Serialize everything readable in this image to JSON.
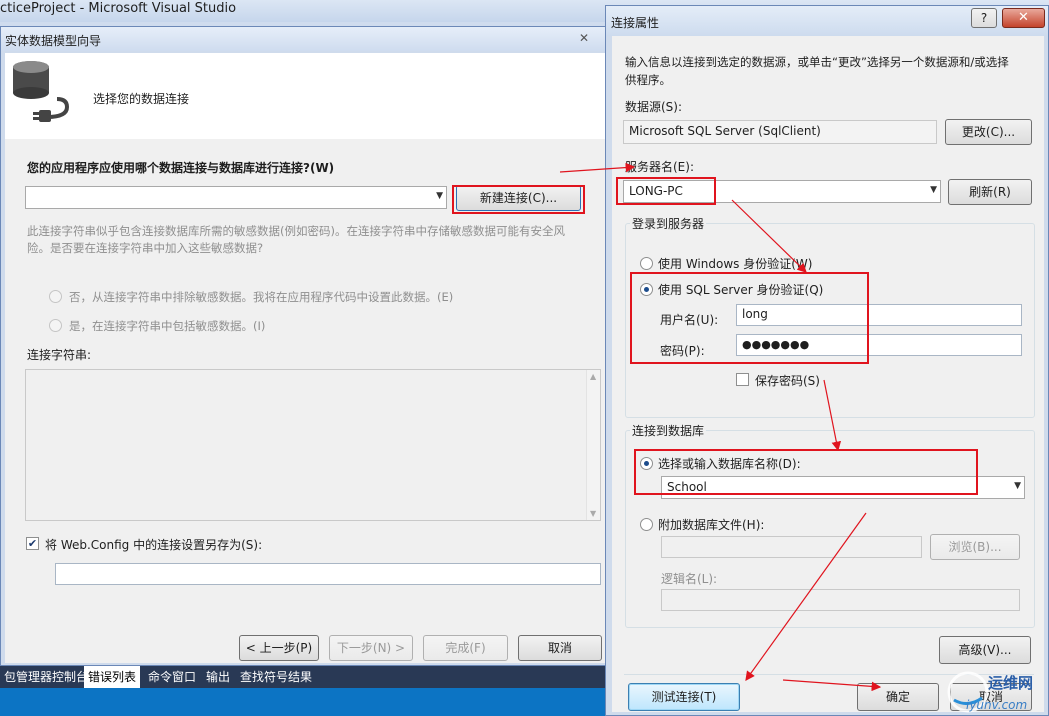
{
  "vs": {
    "title": "cticeProject - Microsoft Visual Studio",
    "bottom_tabs": [
      "包管理器控制台",
      "错误列表",
      "命令窗口",
      "输出",
      "查找符号结果"
    ]
  },
  "wizard": {
    "title": "实体数据模型向导",
    "heading": "选择您的数据连接",
    "question": "您的应用程序应使用哪个数据连接与数据库进行连接?(W)",
    "connection_combo_value": "",
    "new_connection_button": "新建连接(C)...",
    "sensitive_text": "此连接字符串似乎包含连接数据库所需的敏感数据(例如密码)。在连接字符串中存储敏感数据可能有安全风险。是否要在连接字符串中加入这些敏感数据?",
    "sensitive_text_line1": "此连接字符串似乎包含连接数据库所需的敏感数据(例如密码)。在连接字符串中存储敏感数据可能有安全风",
    "sensitive_text_line2": "险。是否要在连接字符串中加入这些敏感数据?",
    "radio_no": "否，从连接字符串中排除敏感数据。我将在应用程序代码中设置此数据。(E)",
    "radio_yes": "是，在连接字符串中包括敏感数据。(I)",
    "conn_string_label": "连接字符串:",
    "save_config_label": "将 Web.Config 中的连接设置另存为(S):",
    "save_config_checked": true,
    "config_name": "",
    "buttons": {
      "prev": "< 上一步(P)",
      "next": "下一步(N) >",
      "finish": "完成(F)",
      "cancel": "取消"
    }
  },
  "conn": {
    "title": "连接属性",
    "help": "?",
    "close": "✕",
    "intro_line1": "输入信息以连接到选定的数据源，或单击“更改”选择另一个数据源和/或选择",
    "intro_line2": "供程序。",
    "datasource_label": "数据源(S):",
    "datasource_value": "Microsoft SQL Server (SqlClient)",
    "change_button": "更改(C)...",
    "server_label": "服务器名(E):",
    "server_value": "LONG-PC",
    "refresh_button": "刷新(R)",
    "login_group": "登录到服务器",
    "auth_windows": "使用 Windows 身份验证(W)",
    "auth_sql": "使用 SQL Server 身份验证(Q)",
    "username_label": "用户名(U):",
    "username_value": "long",
    "password_label": "密码(P):",
    "password_value": "●●●●●●●",
    "save_password": "保存密码(S)",
    "db_group": "连接到数据库",
    "select_db": "选择或输入数据库名称(D):",
    "db_value": "School",
    "attach_db": "附加数据库文件(H):",
    "browse_button": "浏览(B)...",
    "logical_name_label": "逻辑名(L):",
    "advanced_button": "高级(V)...",
    "test_button": "测试连接(T)",
    "ok_button": "确定",
    "cancel_button": "取消"
  },
  "watermark": {
    "text": "运维网",
    "subtext": "iyunv.com"
  }
}
